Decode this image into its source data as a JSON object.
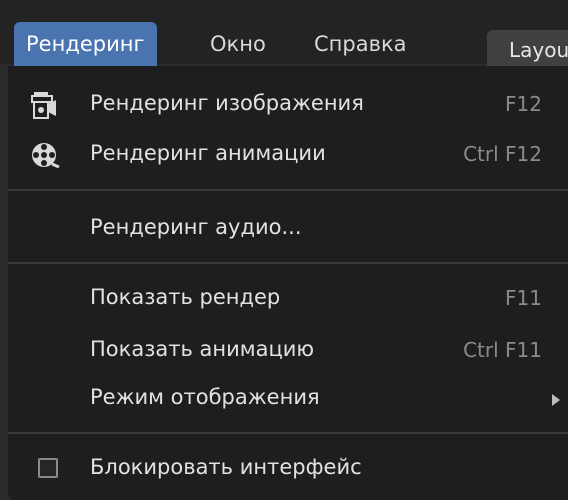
{
  "menubar": {
    "tabs": [
      {
        "label": "Рендеринг",
        "active": true
      },
      {
        "label": "Окно",
        "active": false
      },
      {
        "label": "Справка",
        "active": false
      }
    ],
    "workspace_tab": "Layout"
  },
  "render_menu": {
    "items": [
      {
        "label": "Рендеринг изображения",
        "shortcut": "F12",
        "icon": "render-image-icon"
      },
      {
        "label": "Рендеринг анимации",
        "shortcut": "Ctrl F12",
        "icon": "render-animation-icon"
      },
      {
        "label": "Рендеринг аудио..."
      },
      {
        "label": "Показать рендер",
        "shortcut": "F11"
      },
      {
        "label": "Показать анимацию",
        "shortcut": "Ctrl F11"
      },
      {
        "label": "Режим отображения",
        "submenu": true
      },
      {
        "label": "Блокировать интерфейс",
        "checkbox": true,
        "checked": false
      }
    ]
  },
  "colors": {
    "accent": "#4a74b0",
    "menu_background": "#1e1e1e",
    "topbar_background": "#232323",
    "text": "#e2e2e2",
    "shortcut_text": "#8a8a8a"
  }
}
